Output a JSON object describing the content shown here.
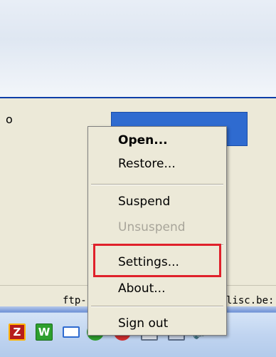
{
  "window": {
    "left_label": "o"
  },
  "status_bar": {
    "left_text": "ftp-:",
    "right_text": "lisc.be:"
  },
  "context_menu": {
    "items": [
      {
        "label": "Open...",
        "bold": true,
        "enabled": true
      },
      {
        "label": "Restore...",
        "bold": false,
        "enabled": true
      },
      {
        "label": "Suspend",
        "bold": false,
        "enabled": true
      },
      {
        "label": "Unsuspend",
        "bold": false,
        "enabled": false
      },
      {
        "label": "Settings...",
        "bold": false,
        "enabled": true,
        "highlighted": true
      },
      {
        "label": "About...",
        "bold": false,
        "enabled": true
      },
      {
        "label": "Sign out",
        "bold": false,
        "enabled": true
      }
    ],
    "highlight_color": "#e0212b"
  },
  "taskbar": {
    "tray_icons": [
      {
        "name": "filezilla-icon",
        "glyph": "Z"
      },
      {
        "name": "w-app-icon",
        "glyph": "W"
      },
      {
        "name": "network-icon",
        "glyph": ""
      },
      {
        "name": "check-shield-icon",
        "glyph": "✔"
      },
      {
        "name": "x-error-icon",
        "glyph": "✖"
      },
      {
        "name": "monitor-icon",
        "glyph": ""
      },
      {
        "name": "terminal-icon",
        "glyph": "▬"
      },
      {
        "name": "speaker-icon",
        "glyph": "🔈"
      }
    ]
  }
}
